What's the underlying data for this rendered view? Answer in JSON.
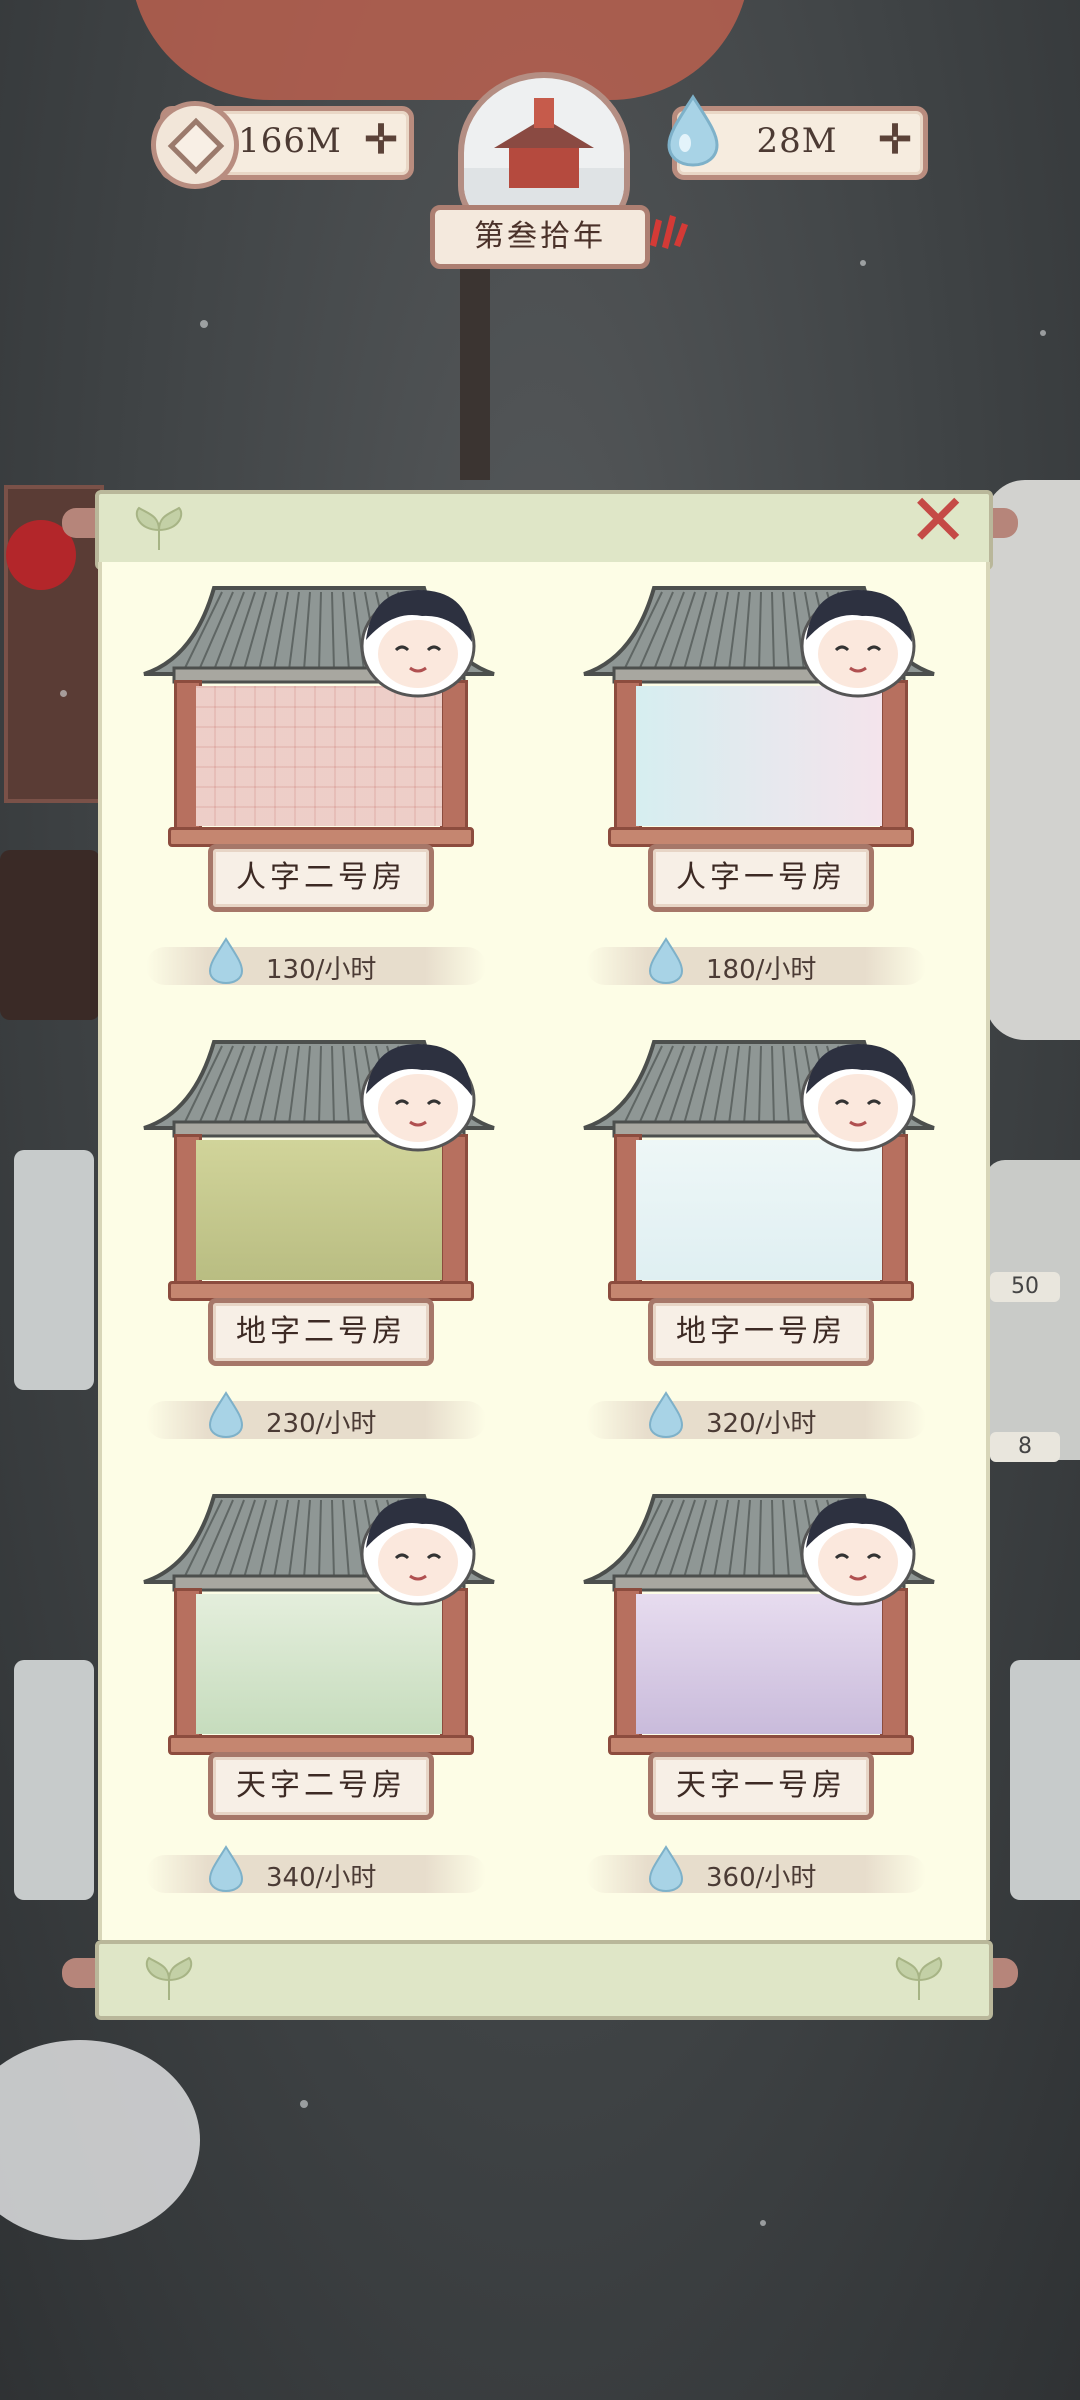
{
  "top_bar": {
    "coins": "166M",
    "essence": "28M",
    "year": "第叁拾年"
  },
  "rooms": [
    {
      "name": "人字二号房",
      "rate": "130/小时"
    },
    {
      "name": "人字一号房",
      "rate": "180/小时"
    },
    {
      "name": "地字二号房",
      "rate": "230/小时"
    },
    {
      "name": "地字一号房",
      "rate": "320/小时"
    },
    {
      "name": "天字二号房",
      "rate": "340/小时"
    },
    {
      "name": "天字一号房",
      "rate": "360/小时"
    }
  ],
  "side_badges": {
    "dish_count": "50",
    "bowl_count": "8"
  },
  "colors": {
    "panel": "#fdfde6",
    "frame": "#b7705f",
    "close": "#c54a46"
  }
}
